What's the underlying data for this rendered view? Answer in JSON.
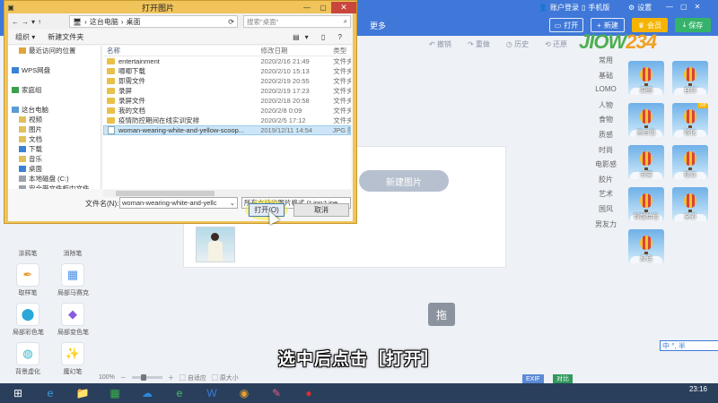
{
  "app": {
    "top_links": [
      "账户登录",
      "手机版",
      "设置"
    ],
    "buttons": {
      "open": "打开",
      "new": "新建",
      "batch": "会员",
      "save": "保存"
    },
    "more": "更多",
    "history": [
      "撤销",
      "重做",
      "历史",
      "还原"
    ],
    "logo_a": "JIOW",
    "logo_b": "234",
    "categories": [
      "常用",
      "基础",
      "LOMO",
      "人物",
      "食物",
      "质感",
      "时尚",
      "电影感",
      "胶片",
      "艺术",
      "国风",
      "男友力"
    ],
    "filters": [
      "原图",
      "自然",
      "黑白色",
      "锐化",
      "去雾",
      "褪淡",
      "智能绘色",
      "全彩",
      "反色"
    ],
    "vip_label": "VIP",
    "new_image": "新建图片",
    "tools": [
      "涂鸦笔",
      "消除笔",
      "取样笔",
      "局部马赛克",
      "局部彩色笔",
      "局部变色笔",
      "背景虚化",
      "魔幻笔"
    ],
    "zoom": "100%",
    "fit_label": "自适应",
    "actual_label": "原大小",
    "exif": "EXIF",
    "compare": "对比",
    "ime": "中 °, 半",
    "drag_icon": "拖"
  },
  "caption": "选中后点击［打开］",
  "taskbar": {
    "apps": [
      "⊞",
      "e",
      "📁",
      "▦",
      "☁",
      "e",
      "W",
      "◉",
      "✎",
      "●"
    ],
    "time": "23:16"
  },
  "dialog": {
    "title": "打开图片",
    "close": "✕",
    "minimize": "—",
    "maximize": "▢",
    "breadcrumb": [
      "这台电脑",
      "桌面"
    ],
    "search_placeholder": "搜索\"桌面\"",
    "organize": "组织 ▾",
    "new_folder": "新建文件夹",
    "nav_items": [
      {
        "label": "最近访问的位置",
        "indent": 1,
        "color": "#e0a53a"
      },
      {
        "label": "",
        "indent": 0,
        "color": "transparent"
      },
      {
        "label": "WPS网盘",
        "indent": 0,
        "color": "#3b82d6"
      },
      {
        "label": "",
        "indent": 0,
        "color": "transparent"
      },
      {
        "label": "家庭组",
        "indent": 0,
        "color": "#3aa04a"
      },
      {
        "label": "",
        "indent": 0,
        "color": "transparent"
      },
      {
        "label": "这台电脑",
        "indent": 0,
        "color": "#5a9bd6"
      },
      {
        "label": "视频",
        "indent": 1,
        "color": "#e0c05a"
      },
      {
        "label": "图片",
        "indent": 1,
        "color": "#e0c05a"
      },
      {
        "label": "文档",
        "indent": 1,
        "color": "#e0c05a"
      },
      {
        "label": "下载",
        "indent": 1,
        "color": "#3b82d6"
      },
      {
        "label": "音乐",
        "indent": 1,
        "color": "#e0c05a"
      },
      {
        "label": "桌面",
        "indent": 1,
        "color": "#3b82d6"
      },
      {
        "label": "本地磁盘 (C:)",
        "indent": 1,
        "color": "#9aa3ad"
      },
      {
        "label": "安全带文件柜中文件",
        "indent": 1,
        "color": "#9aa3ad"
      }
    ],
    "columns": [
      "名称",
      "修改日期",
      "类型"
    ],
    "files": [
      {
        "name": "entertainment",
        "date": "2020/2/16 21:49",
        "type": "文件夹",
        "kind": "folder"
      },
      {
        "name": "唧唧下载",
        "date": "2020/2/10 15:13",
        "type": "文件夹",
        "kind": "folder"
      },
      {
        "name": "即需文件",
        "date": "2020/2/19 20:55",
        "type": "文件夹",
        "kind": "folder"
      },
      {
        "name": "录屏",
        "date": "2020/2/19 17:23",
        "type": "文件夹",
        "kind": "folder"
      },
      {
        "name": "录屏文件",
        "date": "2020/2/18 20:58",
        "type": "文件夹",
        "kind": "folder"
      },
      {
        "name": "我的文档",
        "date": "2020/2/8 0:09",
        "type": "文件夹",
        "kind": "folder"
      },
      {
        "name": "疫情防控期间在线实训安排",
        "date": "2020/2/5 17:12",
        "type": "文件夹",
        "kind": "folder"
      },
      {
        "name": "woman-wearing-white-and-yellow-scoop...",
        "date": "2019/12/11 14:54",
        "type": "JPG 图",
        "kind": "jpg",
        "selected": true
      }
    ],
    "filename_label": "文件名(N):",
    "filename_value": "woman-wearing-white-and-yellc",
    "filetype_value": "所有支持的图片格式 (*.jpg;*.jpe",
    "open_label": "打开(O)",
    "cancel_label": "取消"
  }
}
